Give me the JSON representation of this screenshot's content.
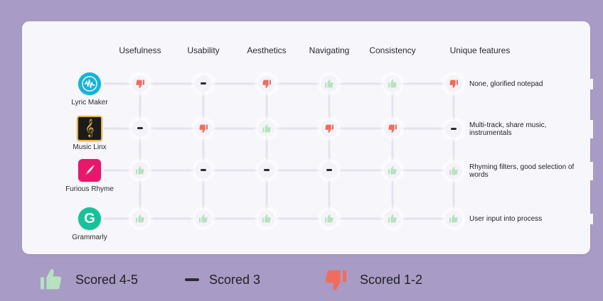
{
  "columns": [
    "Usefulness",
    "Usability",
    "Aesthetics",
    "Navigating",
    "Consistency",
    "Unique features"
  ],
  "apps": [
    {
      "name": "Lyric Maker",
      "icon": "waveform-icon",
      "icon_bg": "#12b5d9",
      "scores": [
        "down",
        "neutral",
        "down",
        "up",
        "up"
      ],
      "unique": {
        "rating": "down",
        "text": "None, glorified notepad"
      }
    },
    {
      "name": "Music Linx",
      "icon": "treble-clef-icon",
      "icon_bg": "#1b1b1b",
      "scores": [
        "neutral",
        "down",
        "up",
        "down",
        "down"
      ],
      "unique": {
        "rating": "neutral",
        "text": "Multi-track, share music, instrumentals"
      }
    },
    {
      "name": "Furious Rhyme",
      "icon": "quill-icon",
      "icon_bg": "#e8176c",
      "scores": [
        "up",
        "neutral",
        "neutral",
        "neutral",
        "up"
      ],
      "unique": {
        "rating": "up",
        "text": "Rhyming filters, good selection of words"
      }
    },
    {
      "name": "Grammarly",
      "icon": "grammarly-g-icon",
      "icon_bg": "#15c39a",
      "scores": [
        "up",
        "up",
        "up",
        "up",
        "up"
      ],
      "unique": {
        "rating": "up",
        "text": "User input into process"
      }
    }
  ],
  "legend": [
    {
      "rating": "up",
      "label": "Scored 4-5"
    },
    {
      "rating": "neutral",
      "label": "Scored 3"
    },
    {
      "rating": "down",
      "label": "Scored 1-2"
    }
  ],
  "colors": {
    "up": "#b6e3bd",
    "neutral": "#2b2b33",
    "down": "#f16c5b",
    "background": "#a89cc6",
    "card": "#f7f6fb"
  }
}
